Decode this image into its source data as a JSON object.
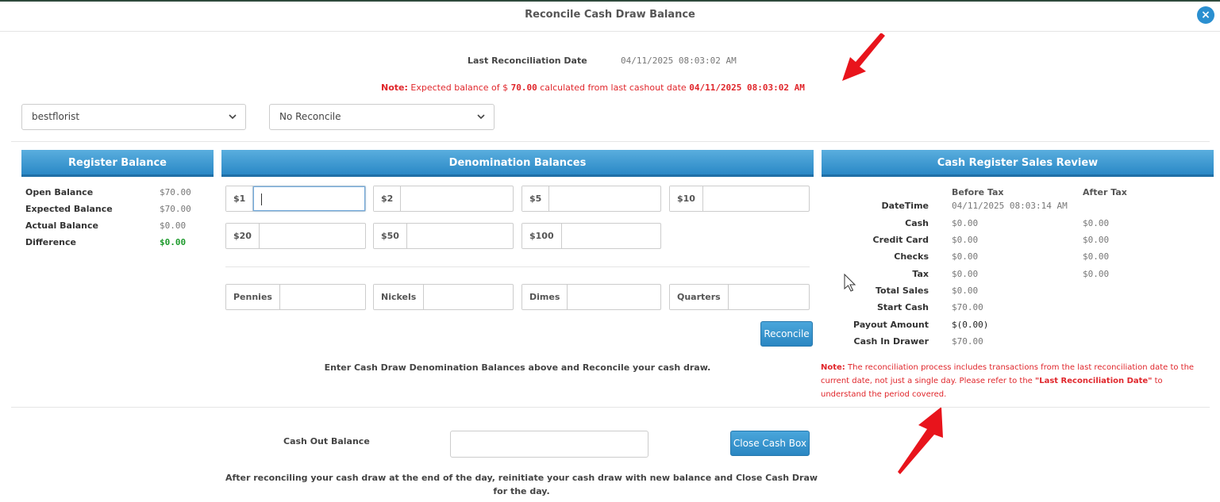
{
  "modal": {
    "title": "Reconcile Cash Draw Balance",
    "close_icon": "×"
  },
  "last_reconciliation": {
    "label": "Last Reconciliation Date",
    "value": "04/11/2025 08:03:02 AM"
  },
  "note_top": {
    "prefix": "Note:",
    "text1": "Expected balance of $",
    "amount": "70.00",
    "text2": "calculated from last cashout date",
    "date": "04/11/2025 08:03:02 AM"
  },
  "store_select": {
    "value": "bestflorist"
  },
  "reconcile_select": {
    "value": "No Reconcile"
  },
  "register_balance": {
    "header": "Register Balance",
    "rows": [
      {
        "label": "Open Balance",
        "value": "$70.00"
      },
      {
        "label": "Expected Balance",
        "value": "$70.00"
      },
      {
        "label": "Actual Balance",
        "value": "$0.00"
      },
      {
        "label": "Difference",
        "value": "$0.00"
      }
    ]
  },
  "denomination": {
    "header": "Denomination Balances",
    "bills": [
      "$1",
      "$2",
      "$5",
      "$10",
      "$20",
      "$50",
      "$100"
    ],
    "coins": [
      "Pennies",
      "Nickels",
      "Dimes",
      "Quarters"
    ],
    "reconcile_button": "Reconcile",
    "instruction": "Enter Cash Draw Denomination Balances above and Reconcile your cash draw."
  },
  "sales_review": {
    "header": "Cash Register Sales Review",
    "col_before": "Before Tax",
    "col_after": "After Tax",
    "rows": [
      {
        "label": "DateTime",
        "before": "04/11/2025 08:03:14 AM",
        "after": ""
      },
      {
        "label": "Cash",
        "before": "$0.00",
        "after": "$0.00"
      },
      {
        "label": "Credit Card",
        "before": "$0.00",
        "after": "$0.00"
      },
      {
        "label": "Checks",
        "before": "$0.00",
        "after": "$0.00"
      },
      {
        "label": "Tax",
        "before": "$0.00",
        "after": "$0.00"
      },
      {
        "label": "Total Sales",
        "before": "$0.00",
        "after": ""
      },
      {
        "label": "Start Cash",
        "before": "$70.00",
        "after": ""
      },
      {
        "label": "Payout Amount",
        "before": "$(0.00)",
        "after": ""
      },
      {
        "label": "Cash In Drawer",
        "before": "$70.00",
        "after": ""
      }
    ],
    "note_prefix": "Note:",
    "note_text1": "The reconciliation process includes transactions from the last reconciliation date to the current date, not just a single day. Please refer to the",
    "note_bold": "\"Last Reconciliation Date\"",
    "note_text2": "to understand the period covered."
  },
  "cash_out": {
    "label": "Cash Out Balance",
    "value": "",
    "button": "Close Cash Box",
    "instruction": "After reconciling your cash draw at the end of the day, reinitiate your cash draw with new balance and Close Cash Draw for the day."
  },
  "colors": {
    "accent": "#2a88c6",
    "note_red": "#e0262b",
    "positive_green": "#1e9a2c",
    "arrow_red": "#e8141c"
  }
}
